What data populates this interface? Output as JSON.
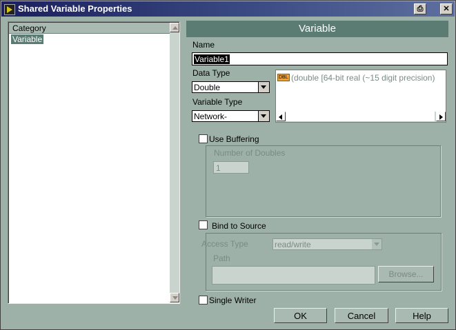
{
  "window": {
    "title": "Shared Variable Properties"
  },
  "category": {
    "header": "Category",
    "items": [
      "Variable"
    ]
  },
  "section": {
    "title": "Variable"
  },
  "name": {
    "label": "Name",
    "value": "Variable1"
  },
  "data_type": {
    "label": "Data Type",
    "value": "Double",
    "badge": "DBL",
    "description": "(double [64-bit real (~15 digit precision)"
  },
  "variable_type": {
    "label": "Variable Type",
    "value": "Network-"
  },
  "buffering": {
    "label": "Use Buffering",
    "checked": false,
    "count_label": "Number of Doubles",
    "count_value": "1"
  },
  "bind": {
    "label": "Bind to Source",
    "checked": false,
    "access_label": "Access Type",
    "access_value": "read/write",
    "path_label": "Path",
    "path_value": "",
    "browse_label": "Browse..."
  },
  "single_writer": {
    "label": "Single Writer",
    "checked": false
  },
  "buttons": {
    "ok": "OK",
    "cancel": "Cancel",
    "help": "Help"
  }
}
